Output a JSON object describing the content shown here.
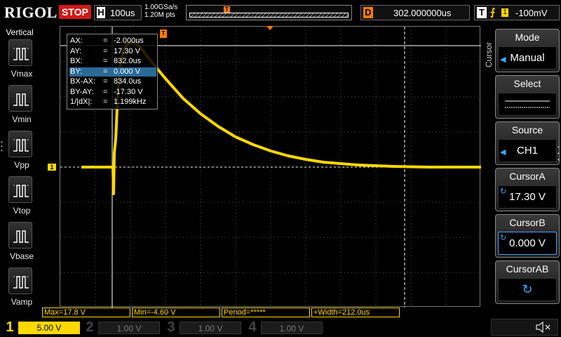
{
  "header": {
    "logo": "RIGOL",
    "run_state": "STOP",
    "timebase_label": "H",
    "timebase_value": "100us",
    "sample_rate": "1.00GSa/s",
    "memory_depth": "1.20M pts",
    "delay_label": "D",
    "delay_value": "302.000000us",
    "trigger_label": "T",
    "trigger_source": "1",
    "trigger_level": "-100mV"
  },
  "left_panel": {
    "title": "Vertical",
    "items": [
      {
        "label": "Vmax",
        "icon": "vmax-icon"
      },
      {
        "label": "Vmin",
        "icon": "vmin-icon"
      },
      {
        "label": "Vpp",
        "icon": "vpp-icon"
      },
      {
        "label": "Vtop",
        "icon": "vtop-icon"
      },
      {
        "label": "Vbase",
        "icon": "vbase-icon"
      },
      {
        "label": "Vamp",
        "icon": "vamp-icon"
      }
    ]
  },
  "cursor_readout": {
    "rows": [
      {
        "label": "AX:",
        "value": "-2.000us"
      },
      {
        "label": "AY:",
        "value": "17.30 V"
      },
      {
        "label": "BX:",
        "value": "832.0us"
      },
      {
        "label": "BY:",
        "value": "0.000 V",
        "selected": true
      },
      {
        "label": "BX-AX:",
        "value": "834.0us"
      },
      {
        "label": "BY-AY:",
        "value": "-17.30 V"
      },
      {
        "label": "1/|dX|:",
        "value": "1.199kHz"
      }
    ],
    "eq": "="
  },
  "right_panel": {
    "side_label": "Cursor",
    "keys": [
      {
        "title": "Mode",
        "value": "Manual"
      },
      {
        "title": "Select",
        "value": ""
      },
      {
        "title": "Source",
        "value": "CH1"
      },
      {
        "title": "CursorA",
        "value": "17.30 V"
      },
      {
        "title": "CursorB",
        "value": "0.000 V"
      },
      {
        "title": "CursorAB",
        "value": ""
      }
    ]
  },
  "markers": {
    "ch1_ground": "1",
    "trigger_level": "T",
    "trigger_pos": "T"
  },
  "measurements": [
    {
      "text": "Max=17.8 V"
    },
    {
      "text": "Min=-4.60 V"
    },
    {
      "text": "Period=*****"
    },
    {
      "text": "+Width=212.0us"
    }
  ],
  "channels": [
    {
      "num": "1",
      "scale": "5.00 V",
      "active": true
    },
    {
      "num": "2",
      "scale": "1.00 V",
      "active": false
    },
    {
      "num": "3",
      "scale": "1.00 V",
      "active": false
    },
    {
      "num": "4",
      "scale": "1.00 V",
      "active": false
    }
  ],
  "colors": {
    "ch1": "#ffd800",
    "trigger": "#ff7a00",
    "stop": "#d21818",
    "accent": "#39a9ff"
  },
  "chart_data": {
    "type": "line",
    "series": [
      {
        "x": [
          -40,
          -20,
          0,
          2,
          4,
          6,
          8,
          10,
          12,
          14,
          16,
          20,
          30,
          40,
          60,
          80,
          100,
          150,
          200,
          250,
          300,
          350,
          400,
          450,
          500,
          550,
          600,
          650,
          700,
          750,
          800,
          850,
          900
        ],
        "y": [
          0,
          0,
          0,
          -3.8,
          2,
          3,
          4,
          6,
          8.5,
          10.5,
          12,
          14.2,
          16.5,
          17.5,
          17.8,
          17.0,
          15.6,
          12.6,
          9.8,
          7.6,
          5.8,
          4.3,
          3.2,
          2.3,
          1.6,
          1.1,
          0.7,
          0.5,
          0.3,
          0.2,
          0.1,
          0.05,
          0.0
        ]
      }
    ],
    "xlim": [
      -150,
      1050
    ],
    "ylim": [
      -20,
      20
    ],
    "grid": true
  }
}
